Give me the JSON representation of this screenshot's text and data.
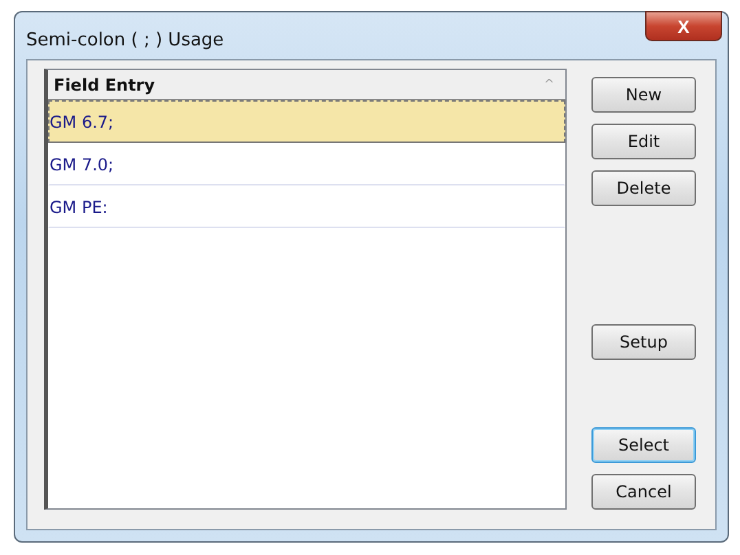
{
  "window": {
    "title": "Semi-colon ( ; ) Usage",
    "close": "X"
  },
  "list": {
    "column": {
      "label": "Field Entry",
      "sort": "^"
    },
    "rows": [
      {
        "label": "GM 6.7;",
        "selected": true
      },
      {
        "label": "GM 7.0;",
        "selected": false
      },
      {
        "label": "GM PE:",
        "selected": false
      }
    ]
  },
  "button_groups": [
    [
      {
        "label": "New",
        "default": false
      },
      {
        "label": "Edit",
        "default": false
      },
      {
        "label": "Delete",
        "default": false
      }
    ],
    [
      {
        "label": "Setup",
        "default": false
      }
    ],
    [
      {
        "label": "Select",
        "default": true
      },
      {
        "label": "Cancel",
        "default": false
      }
    ]
  ]
}
